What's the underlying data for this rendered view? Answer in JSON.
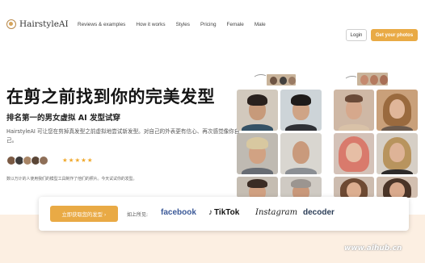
{
  "nav": {
    "logo": "HairstyleAI",
    "menu": [
      "Reviews & examples",
      "How it works",
      "Styles",
      "Pricing",
      "Female",
      "Male"
    ],
    "login": "Login",
    "get_photos": "Get your photos"
  },
  "hero": {
    "title": "在剪之前找到你的完美发型",
    "subtitle": "排名第一的男女虚拟 AI 发型试穿",
    "description": "HairstyleAI 可让您在剪掉真发型之前虚拟地尝试新发型。对自己的外表更有信心、再次感觉像你自己。",
    "stars": "★★★★★",
    "social_proof": "数以万计的人使用我们的模型工具制作了他们的照片。今天试试你的发型。"
  },
  "cta": {
    "button": "立即获取您的发型 ›",
    "seen_on": "如上所见:",
    "brands": [
      "facebook",
      "TikTok",
      "Instagram",
      "decoder"
    ]
  },
  "watermark": "www.aihub.cn",
  "colors": {
    "accent": "#e9aa45",
    "band": "#fcefe2",
    "facebook": "#3b5998"
  }
}
